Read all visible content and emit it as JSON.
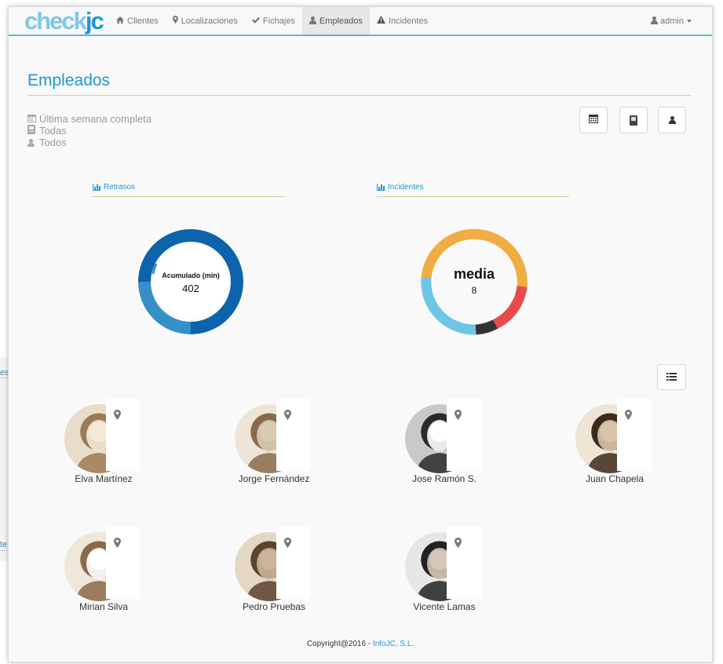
{
  "brand": {
    "logo_text_a": "check",
    "logo_text_b": "jc"
  },
  "nav": {
    "items": [
      {
        "label": "Clientes",
        "icon": "home-icon"
      },
      {
        "label": "Localizaciones",
        "icon": "map-marker-icon"
      },
      {
        "label": "Fichajes",
        "icon": "check-icon"
      },
      {
        "label": "Empleados",
        "icon": "user-icon",
        "active": true
      },
      {
        "label": "Incidentes",
        "icon": "warning-icon"
      }
    ],
    "user": {
      "label": "admin",
      "icon": "user-icon"
    }
  },
  "page": {
    "title": "Empleados",
    "filters": {
      "period": "Última semana completa",
      "device": "Todas",
      "employees": "Todos"
    }
  },
  "charts": {
    "retrasos": {
      "title": "Retrasos",
      "center_label": "Acumulado (min)",
      "center_value": "402"
    },
    "incidentes": {
      "title": "Incidentes",
      "center_label": "media",
      "center_value": "8"
    }
  },
  "employees": [
    {
      "name": "Elva Martínez"
    },
    {
      "name": "Jorge Fernández"
    },
    {
      "name": "Jose Ramón S."
    },
    {
      "name": "Juan Chapela"
    },
    {
      "name": "Mirian Silva"
    },
    {
      "name": "Pedro Pruebas"
    },
    {
      "name": "Vicente Lamas"
    }
  ],
  "footer": {
    "text": "Copyright@2016 - ",
    "link": "InfoJC, S.L."
  },
  "background_window": {
    "fragment_top": "es",
    "fragment_bottom": "te"
  },
  "colors": {
    "accent": "#1f97d4",
    "retrasos_outer": "#0d63ac",
    "retrasos_inner": "#3590c8",
    "incid_orange": "#f0ad40",
    "incid_red": "#e84b4b",
    "incid_dark": "#333333",
    "incid_lightblue": "#6ec6e6"
  }
}
